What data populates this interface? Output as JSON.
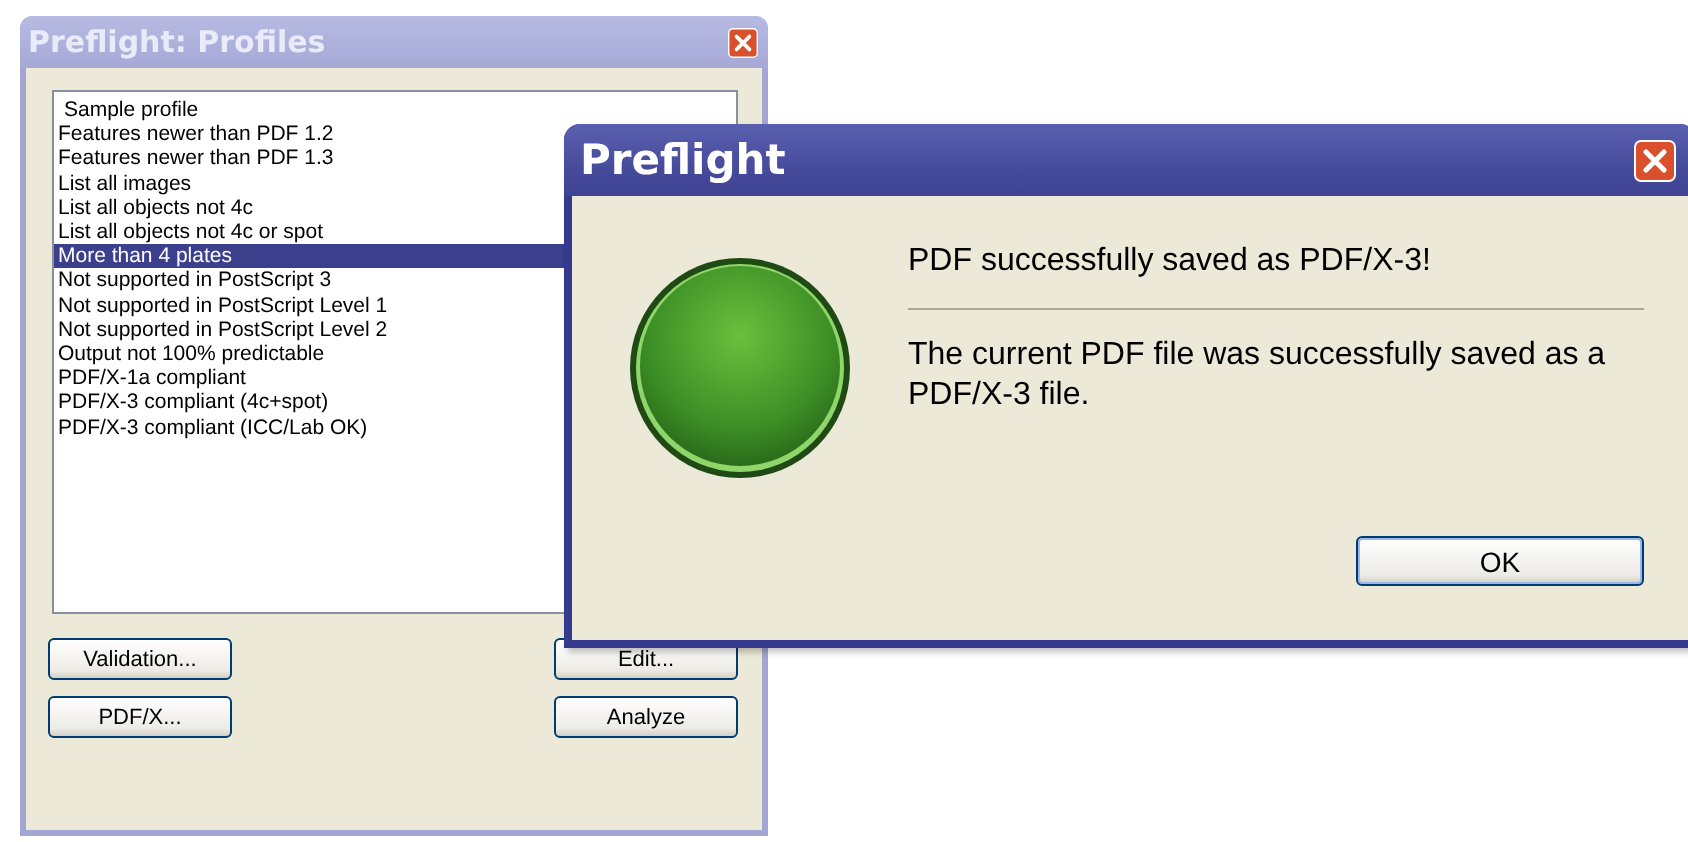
{
  "profiles_window": {
    "title": "Preflight: Profiles",
    "profiles": [
      {
        "label": "Sample profile",
        "selected": false
      },
      {
        "label": "Features newer than PDF 1.2",
        "selected": false
      },
      {
        "label": "Features newer than PDF 1.3",
        "selected": false
      },
      {
        "label": "List all images",
        "selected": false
      },
      {
        "label": "List all objects not 4c",
        "selected": false
      },
      {
        "label": "List all objects not 4c or spot",
        "selected": false
      },
      {
        "label": "More than 4 plates",
        "selected": true
      },
      {
        "label": "Not supported in PostScript 3",
        "selected": false
      },
      {
        "label": "Not supported in PostScript Level 1",
        "selected": false
      },
      {
        "label": "Not supported in PostScript Level 2",
        "selected": false
      },
      {
        "label": "Output not 100% predictable",
        "selected": false
      },
      {
        "label": "PDF/X-1a compliant",
        "selected": false
      },
      {
        "label": "PDF/X-3 compliant (4c+spot)",
        "selected": false
      },
      {
        "label": "PDF/X-3 compliant (ICC/Lab OK)",
        "selected": false
      }
    ],
    "buttons": [
      "Validation...",
      "Edit...",
      "PDF/X...",
      "Analyze"
    ]
  },
  "dialog": {
    "title": "Preflight",
    "heading": "PDF successfully saved as PDF/X-3!",
    "message": "The current PDF file was successfully saved as a PDF/X-3 file.",
    "buttons": [
      "OK"
    ]
  }
}
